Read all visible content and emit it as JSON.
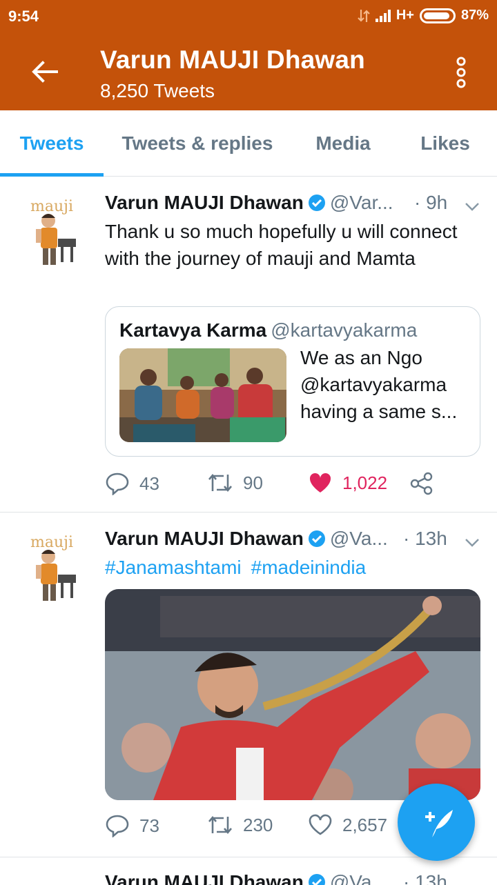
{
  "status": {
    "time": "9:54",
    "network": "H+",
    "battery": "87%"
  },
  "header": {
    "title": "Varun MAUJI Dhawan",
    "subtitle": "8,250 Tweets",
    "back_icon": "arrow-left-icon",
    "menu_icon": "more-vertical-icon"
  },
  "tabs": [
    {
      "label": "Tweets",
      "active": true
    },
    {
      "label": "Tweets & replies",
      "active": false
    },
    {
      "label": "Media",
      "active": false
    },
    {
      "label": "Likes",
      "active": false
    }
  ],
  "tweets": [
    {
      "name": "Varun MAUJI Dhawan",
      "handle": "@Var...",
      "time": "· 9h",
      "text": "Thank u so much hopefully u will connect with the journey of mauji and Mamta",
      "quote": {
        "name": "Kartavya Karma",
        "handle": "@kartavyakarma",
        "text": "We as an Ngo @kartavyakarma having a same s..."
      },
      "replies": "43",
      "retweets": "90",
      "likes": "1,022",
      "liked": true
    },
    {
      "name": "Varun MAUJI Dhawan",
      "handle": "@Va...",
      "time": "· 13h",
      "hashtags": [
        "#Janamashtami",
        "#madeinindia"
      ],
      "replies": "73",
      "retweets": "230",
      "likes": "2,657",
      "liked": false
    },
    {
      "name": "Varun MAUJI Dhawan",
      "handle": "@Va...",
      "time": "· 13h"
    }
  ],
  "avatar_text": "mauji",
  "colors": {
    "header": "#c4520a",
    "accent": "#1da1f2",
    "like": "#e0245e",
    "muted": "#657786"
  }
}
